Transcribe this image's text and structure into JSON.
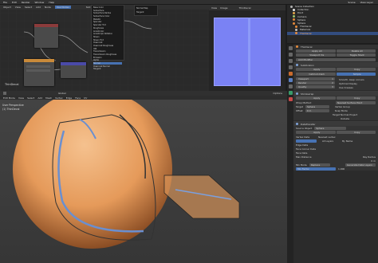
{
  "topbar": {
    "menus": [
      "File",
      "Edit",
      "Render",
      "Window",
      "Help"
    ],
    "workspace": "Scene",
    "layer": "View Layer"
  },
  "node_editor": {
    "header": [
      "Object",
      "View",
      "Select",
      "Add",
      "Node"
    ],
    "use_nodes_label": "Use Nodes",
    "slot": "Slot 1",
    "material": "ThinDecal",
    "frame_label": "ThinDecal",
    "menu_items": [
      "Base Color",
      "Subsurface",
      "Subsurface Radius",
      "Subsurface Color",
      "Metallic",
      "Specular",
      "Specular Tint",
      "Roughness",
      "Anisotropic",
      "Anisotropic Rotation",
      "Sheen",
      "Sheen Tint",
      "Clearcoat",
      "Clearcoat Roughness",
      "IOR",
      "Transmission",
      "Transmission Roughness",
      "Emission",
      "Alpha",
      "Normal",
      "Clearcoat Normal",
      "Tangent"
    ],
    "submenu_items": [
      "Normal Map",
      "Tangent"
    ]
  },
  "image_editor": {
    "header": [
      "View",
      "Image"
    ],
    "image_name": "ThinDecal"
  },
  "outliner": {
    "items": [
      {
        "label": "Scene Collection",
        "color": "#b0b0b0"
      },
      {
        "label": "Collection",
        "color": "#e8e8e8"
      },
      {
        "label": "Point",
        "color": "#e4a54a"
      },
      {
        "label": "Camera",
        "color": "#a0c46b"
      },
      {
        "label": "Sphere",
        "color": "#e58a3a"
      },
      {
        "label": "Sphere",
        "color": "#e58a3a"
      },
      {
        "label": "ThinDecal",
        "color": "#e58a3a"
      },
      {
        "label": "Materials",
        "color": "#c0c0c0"
      },
      {
        "label": "ThinDecal",
        "color": "#e58a3a"
      }
    ]
  },
  "properties": {
    "object_name": "ThinDecal",
    "apply_buttons": [
      "Apply All",
      "Delete All",
      "Viewport Vis",
      "Toggle Stack"
    ],
    "add_modifier": "Add Modifier",
    "modifiers": [
      {
        "name": "Subdivision",
        "buttons": [
          "Apply",
          "Copy"
        ],
        "options": [
          "Catmull-Clark",
          "Simple"
        ],
        "fields": [
          [
            "Viewport",
            "1"
          ],
          [
            "Render",
            "2"
          ],
          [
            "Quality",
            "3"
          ]
        ],
        "checks": [
          "Smooth, keep corners",
          "Optimal Display",
          "Use Creases"
        ]
      },
      {
        "name": "Shrinkwrap",
        "buttons": [
          "Apply",
          "Copy"
        ],
        "fields": [
          [
            "Wrap Method",
            "Nearest Surface Point"
          ],
          [
            "Target",
            "Sphere"
          ],
          [
            "Offset",
            "0 m"
          ]
        ],
        "extra": [
          "Vertex Group",
          "Snap Mode",
          "Target Normal Project",
          "Outside"
        ]
      },
      {
        "name": "DataTransfer",
        "buttons": [
          "Apply",
          "Copy"
        ],
        "fields": [
          [
            "Source Object",
            "Sphere"
          ],
          [
            "Object Transform",
            ""
          ],
          [
            "Mix Mode",
            "Replace"
          ],
          [
            "Mix Factor",
            "1.000"
          ]
        ],
        "checks": [
          "Vertex Data",
          "Edge Data",
          "Face Corner Data",
          "Face Data"
        ],
        "extra": [
          "Nearest vertex",
          "All Layers",
          "By Name",
          "Max Distance",
          "Ray Radius",
          "0 m",
          "Generate Data Layers"
        ]
      }
    ]
  },
  "viewport": {
    "header": [
      "Edit Mode",
      "View",
      "Select",
      "Add",
      "Mesh",
      "Vertex",
      "Edge",
      "Face",
      "UV"
    ],
    "transform": "Global",
    "options_label": "Options",
    "info_line1": "User Perspective",
    "info_line2": "(1) ThinDecal"
  }
}
